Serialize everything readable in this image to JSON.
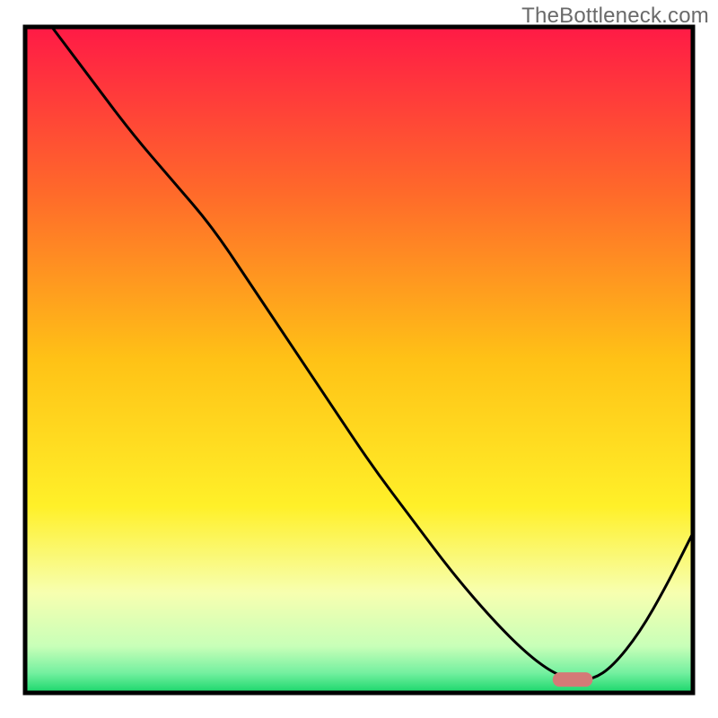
{
  "watermark": "TheBottleneck.com",
  "chart_data": {
    "type": "line",
    "title": "",
    "xlabel": "",
    "ylabel": "",
    "xlim": [
      0,
      100
    ],
    "ylim": [
      0,
      100
    ],
    "grid": false,
    "legend": false,
    "series": [
      {
        "name": "bottleneck-curve",
        "color": "#000000",
        "x": [
          4,
          10,
          16,
          22,
          28,
          34,
          40,
          46,
          52,
          58,
          64,
          70,
          75,
          79,
          82,
          85,
          88,
          92,
          96,
          100
        ],
        "y": [
          100,
          92,
          84,
          77,
          70,
          61,
          52,
          43,
          34,
          26,
          18,
          11,
          6,
          3,
          2,
          2,
          4,
          9,
          16,
          24
        ]
      }
    ],
    "marker": {
      "name": "optimal-range",
      "color": "#d47a77",
      "x_start": 79,
      "x_end": 85,
      "y": 2
    },
    "background_gradient": {
      "stops": [
        {
          "offset": 0.0,
          "color": "#ff1a46"
        },
        {
          "offset": 0.25,
          "color": "#ff6a2a"
        },
        {
          "offset": 0.5,
          "color": "#ffc216"
        },
        {
          "offset": 0.72,
          "color": "#fff029"
        },
        {
          "offset": 0.85,
          "color": "#f7ffb0"
        },
        {
          "offset": 0.93,
          "color": "#c8ffb8"
        },
        {
          "offset": 0.97,
          "color": "#74f0a0"
        },
        {
          "offset": 1.0,
          "color": "#18d66a"
        }
      ]
    }
  }
}
